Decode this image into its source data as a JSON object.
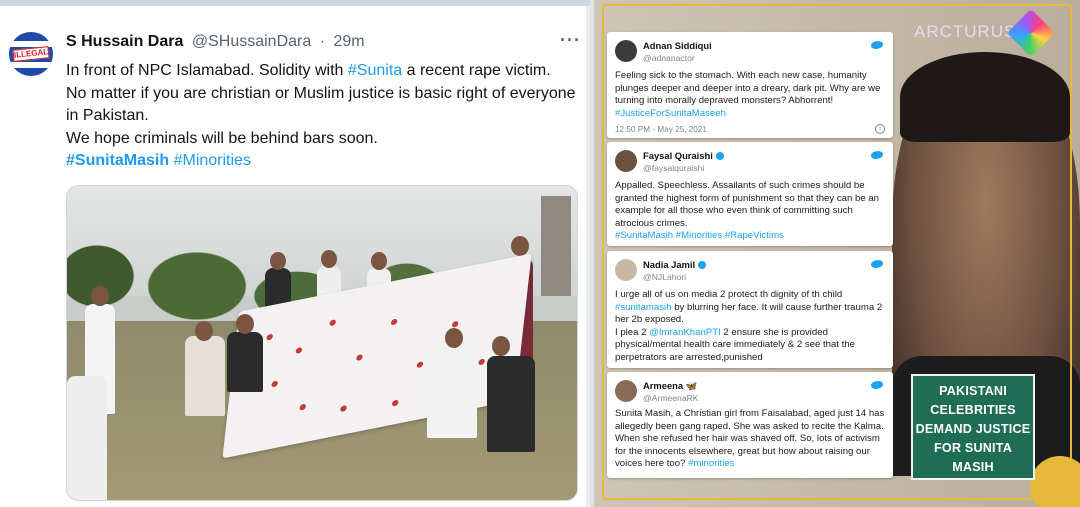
{
  "tweet": {
    "name": "S Hussain Dara",
    "handle": "@SHussainDara",
    "separator": "·",
    "time": "29m",
    "more": "···",
    "avatar_text": "ILLEGAL",
    "line1_pre": "In front of NPC Islamabad. Solidity with ",
    "line1_tag": "#Sunita",
    "line1_post": " a recent rape victim.",
    "line2": "No matter if you are christian or Muslim justice is basic right of everyone in Pakistan.",
    "line3": "We hope criminals will be behind bars soon.",
    "tag1": "#SunitaMasih",
    "tag2": "#Minorities"
  },
  "collage": {
    "brand": "ARCTURUS",
    "caption": "PAKISTANI CELEBRITIES DEMAND JUSTICE FOR SUNITA MASIH",
    "cards": [
      {
        "name": "Adnan Siddiqui",
        "handle": "@adnanactor",
        "text": "Feeling sick to the stomach. With each new case, humanity plunges deeper and deeper into a dreary, dark pit. Why are we turning into morally depraved monsters? Abhorrent!",
        "tag": "#JusticeForSunitaMaseeh",
        "meta": "12:50 PM - May 25, 2021",
        "info": "i"
      },
      {
        "name": "Faysal Quraishi",
        "handle": "@faysalquraishi",
        "text": "Appalled. Speechless. Assailants of such crimes should be granted the highest form of punishment so that they can be an example for all those who even think of committing such atrocious crimes.",
        "tag": "#SunitaMasih #Minorities #RapeVictims"
      },
      {
        "name": "Nadia Jamil",
        "handle": "@NJLahori",
        "text_pre": "I urge all of us on media 2 protect th dignity of th child",
        "tag": "#sunitamasih",
        "text_mid": " by blurring her face. It will cause further trauma 2 her 2b exposed.",
        "text_plea_pre": "I plea 2 ",
        "mention": "@ImranKhanPTI",
        "text_post": " 2 ensure she is provided physical/mental health care immediately & 2 see that the perpetrators are arrested,punished"
      },
      {
        "name": "Armeena",
        "name_suffix": "🦋",
        "handle": "@ArmeenaRK",
        "text": "Sunita Masih, a Christian girl from Faisalabad, aged just 14 has allegedly been gang raped. She was asked to recite the Kalma. When she refused her hair was shaved off. So, lots of activism for the innocents elsewhere, great but how about raising our voices here too?",
        "tag": "#minorities"
      }
    ]
  },
  "colors": {
    "twitter_blue": "#1d9bf0",
    "caption_green": "#1f6d54",
    "frame_gold": "#e7b93a"
  }
}
